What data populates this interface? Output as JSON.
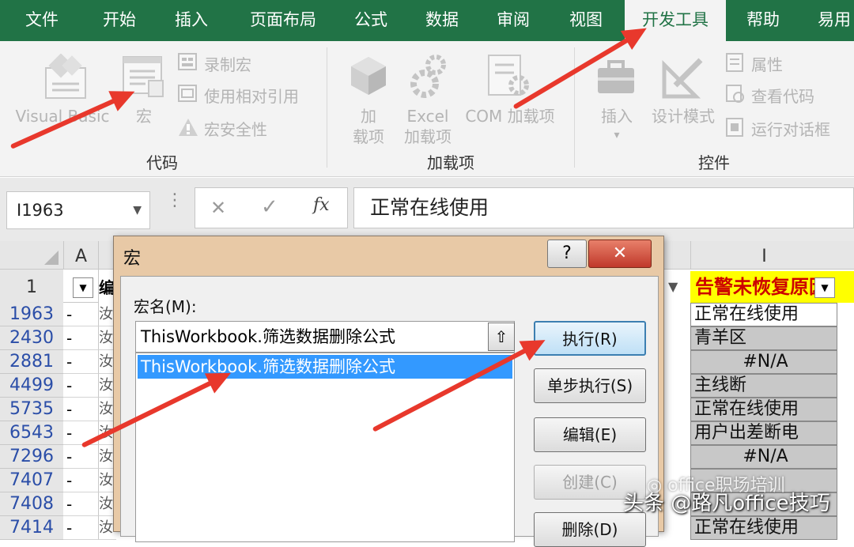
{
  "ribbon_tabs": [
    {
      "label": "文件",
      "active": false
    },
    {
      "label": "开始",
      "active": false
    },
    {
      "label": "插入",
      "active": false
    },
    {
      "label": "页面布局",
      "active": false
    },
    {
      "label": "公式",
      "active": false
    },
    {
      "label": "数据",
      "active": false
    },
    {
      "label": "审阅",
      "active": false
    },
    {
      "label": "视图",
      "active": false
    },
    {
      "label": "开发工具",
      "active": true
    },
    {
      "label": "帮助",
      "active": false
    },
    {
      "label": "易用",
      "active": false
    }
  ],
  "ribbon": {
    "code_group": {
      "label": "代码",
      "visual_basic": "Visual Basic",
      "macros": "宏",
      "record_macro": "录制宏",
      "relative_refs": "使用相对引用",
      "macro_security": "宏安全性"
    },
    "addins_group": {
      "label": "加载项",
      "addins_line1": "加",
      "addins_line2": "载项",
      "excel_addins_line1": "Excel",
      "excel_addins_line2": "加载项",
      "com_addins": "COM 加载项"
    },
    "controls_group": {
      "label": "控件",
      "insert": "插入",
      "design_mode": "设计模式",
      "properties": "属性",
      "view_code": "查看代码",
      "run_dialog": "运行对话框"
    }
  },
  "formula_bar": {
    "name_box": "I1963",
    "cancel_symbol": "✕",
    "enter_symbol": "✓",
    "fx_label": "fx",
    "content": "正常在线使用"
  },
  "sheet": {
    "col_A": "A",
    "col_I": "I",
    "header_row_num": "1",
    "header_B_partial": "编",
    "header_I": "告警未恢复原因",
    "rows": [
      {
        "num": "1963",
        "a": "-",
        "b": "汝",
        "i": "正常在线使用",
        "i_style": "white"
      },
      {
        "num": "2430",
        "a": "-",
        "b": "汝",
        "i": "青羊区",
        "i_style": "gray"
      },
      {
        "num": "2881",
        "a": "-",
        "b": "汝",
        "i": "#N/A",
        "i_style": "center"
      },
      {
        "num": "4499",
        "a": "-",
        "b": "汝",
        "i": "主线断",
        "i_style": "gray"
      },
      {
        "num": "5735",
        "a": "-",
        "b": "汝",
        "i": "正常在线使用",
        "i_style": "gray"
      },
      {
        "num": "6543",
        "a": "-",
        "b": "汝",
        "i": "用户出差断电",
        "i_style": "gray"
      },
      {
        "num": "7296",
        "a": "-",
        "b": "汝",
        "i": "#N/A",
        "i_style": "center"
      },
      {
        "num": "7407",
        "a": "-",
        "b": "汝",
        "i": "",
        "i_style": "gray"
      },
      {
        "num": "7408",
        "a": "-",
        "b": "汝",
        "i": "",
        "i_style": "gray"
      },
      {
        "num": "7414",
        "a": "-",
        "b": "汝",
        "i": "正常在线使用",
        "i_style": "gray"
      }
    ]
  },
  "dialog": {
    "title": "宏",
    "help_button": "?",
    "close_button": "✕",
    "macro_name_label": "宏名(M):",
    "macro_name_value": "ThisWorkbook.筛选数据删除公式",
    "macro_list": [
      "ThisWorkbook.筛选数据删除公式"
    ],
    "buttons": {
      "run": "执行(R)",
      "step_into": "单步执行(S)",
      "edit": "编辑(E)",
      "create": "创建(C)",
      "delete": "删除(D)"
    }
  },
  "watermark": {
    "wechat": "office职场培训",
    "toutiao": "头条 @路凡office技巧"
  },
  "colors": {
    "ribbon_green": "#217346",
    "arrow_red": "#e8382c",
    "selection_blue": "#3399ff",
    "header_yellow": "#ffff00",
    "header_red_text": "#cc0000"
  }
}
